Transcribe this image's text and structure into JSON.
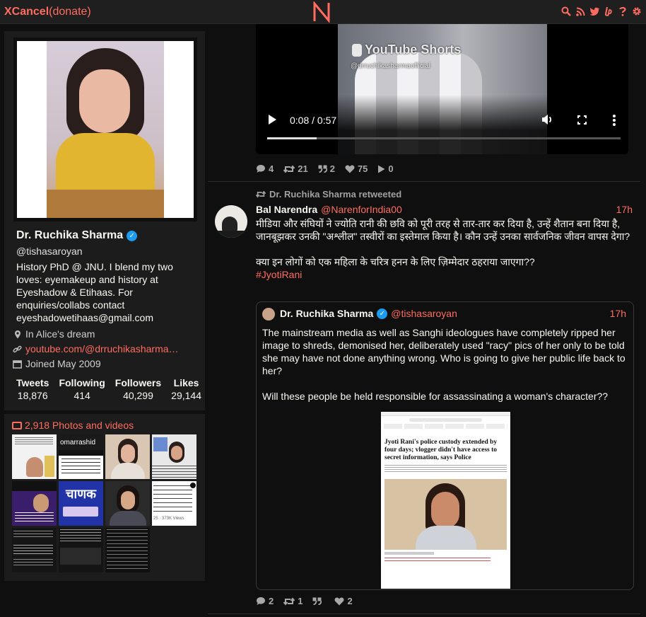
{
  "header": {
    "brand": "XCancel",
    "donate": "(donate)",
    "logo_letter": "N",
    "icons": [
      "search-icon",
      "rss-icon",
      "twitter-icon",
      "liberapay-icon",
      "help-icon",
      "gear-icon"
    ],
    "accent_color": "#ff6c60"
  },
  "profile": {
    "name": "Dr. Ruchika Sharma",
    "verified": true,
    "handle": "@tishasaroyan",
    "bio": "History PhD @ JNU. I blend my two loves: eyemakeup and history at Eyeshadow & Etihaas. For enquiries/collabs contact eyeshadowetihaas@gmail.com",
    "location": "In Alice's dream",
    "website": "youtube.com/@drruchikasharma…",
    "joined": "Joined May 2009",
    "stats": [
      {
        "label": "Tweets",
        "value": "18,876"
      },
      {
        "label": "Following",
        "value": "414"
      },
      {
        "label": "Followers",
        "value": "40,299"
      },
      {
        "label": "Likes",
        "value": "29,144"
      }
    ]
  },
  "photos": {
    "title": "2,918 Photos and videos",
    "thumb_texts": [
      "",
      "omarrashid",
      "",
      "",
      "",
      "चाणक",
      "",
      "25 · 373K Views",
      "",
      "",
      "",
      ""
    ]
  },
  "video_tweet": {
    "overlay_brand": "YouTube Shorts",
    "overlay_handle": "@drruchikasharmaofficial",
    "time": "0:08 / 0:57",
    "progress": 0.14,
    "stats": {
      "replies": "4",
      "retweets": "21",
      "quotes": "2",
      "likes": "75",
      "views": "0"
    }
  },
  "retweet": {
    "retweeted_by": "Dr. Ruchika Sharma retweeted",
    "author_name": "Bal Narendra",
    "author_handle": "@NarenforIndia00",
    "date": "17h",
    "paragraph1": "मीडिया और संघियों ने ज्योति रानी की छवि को पूरी तरह से तार-तार कर दिया है, उन्हें शैतान बना दिया है, जानबूझकर उनकी \"अश्लील\" तस्वीरों का इस्तेमाल किया है। कौन उन्हें उनका सार्वजनिक जीवन वापस देगा?",
    "paragraph2": "क्या इन लोगों को एक महिला के चरित्र हनन के लिए ज़िम्मेदार ठहराया जाएगा??",
    "hashtag": "#JyotiRani",
    "quote": {
      "author_name": "Dr. Ruchika Sharma",
      "author_handle": "@tishasaroyan",
      "date": "17h",
      "paragraph1": "The mainstream media as well as Sanghi ideologues have completely ripped her image to shreds, demonised her, deliberately used \"racy\" pics of her only to be told she may have not done anything wrong. Who is going to give her public life back to her?",
      "paragraph2": "Will these people be held responsible for assassinating a woman's character??",
      "article_headline": "Jyoti Rani's police custody extended by four days; vlogger didn't have access to secret information, says Police"
    },
    "stats": {
      "replies": "2",
      "retweets": "1",
      "quotes": "",
      "likes": "2"
    }
  }
}
